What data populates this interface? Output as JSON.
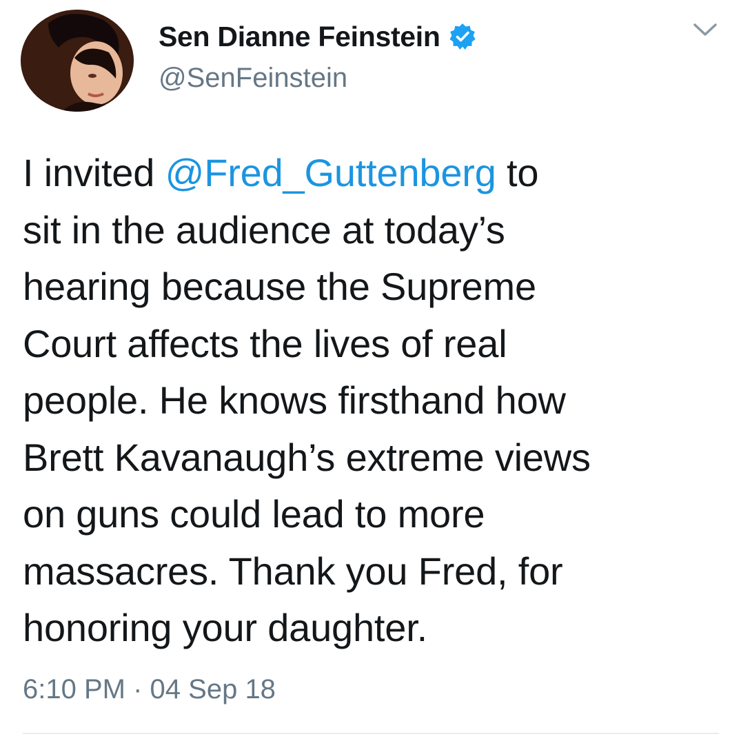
{
  "author": {
    "name": "Sen Dianne Feinstein",
    "handle": "@SenFeinstein",
    "verified": true,
    "avatar_icon": "profile-photo",
    "verified_icon": "verified-badge-icon",
    "verified_color": "#1da1f2"
  },
  "menu": {
    "icon": "chevron-down-icon"
  },
  "tweet": {
    "lines": [
      {
        "before": "I invited ",
        "mention": "@Fred_Guttenberg",
        "after": " to"
      },
      {
        "text": "sit in the audience at today’s"
      },
      {
        "text": "hearing because the Supreme"
      },
      {
        "text": "Court affects the lives of real"
      },
      {
        "text": "people. He knows firsthand how"
      },
      {
        "text": "Brett Kavanaugh’s extreme views"
      },
      {
        "text": "on guns could lead to more"
      },
      {
        "text": "massacres. Thank you Fred, for"
      },
      {
        "text": "honoring your daughter."
      }
    ],
    "mention_color": "#1b95e0"
  },
  "meta": {
    "time": "6:10 PM",
    "separator": "·",
    "date": "04 Sep 18"
  }
}
